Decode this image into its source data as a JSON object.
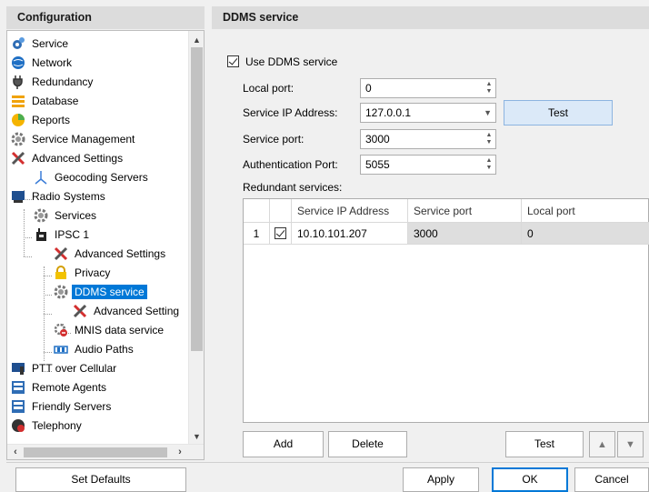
{
  "left_pane": {
    "title": "Configuration",
    "tree": [
      {
        "label": "Service",
        "icon": "gear-blue-icon"
      },
      {
        "label": "Network",
        "icon": "globe-icon"
      },
      {
        "label": "Redundancy",
        "icon": "plug-icon"
      },
      {
        "label": "Database",
        "icon": "database-icon"
      },
      {
        "label": "Reports",
        "icon": "reports-icon"
      },
      {
        "label": "Service Management",
        "icon": "gear-icon"
      },
      {
        "label": "Advanced Settings",
        "icon": "tools-icon"
      },
      {
        "label": "Geocoding Servers",
        "icon": "compass-icon"
      },
      {
        "label": "Radio Systems",
        "icon": "radio-systems-icon"
      },
      {
        "label": "Services",
        "icon": "gear-icon"
      },
      {
        "label": "IPSC 1",
        "icon": "radio-icon"
      },
      {
        "label": "Advanced Settings",
        "icon": "tools-icon"
      },
      {
        "label": "Privacy",
        "icon": "lock-icon"
      },
      {
        "label": "DDMS service",
        "icon": "gear-icon"
      },
      {
        "label": "Advanced Setting",
        "icon": "tools-icon"
      },
      {
        "label": "MNIS data service",
        "icon": "mnis-icon"
      },
      {
        "label": "Audio Paths",
        "icon": "audio-paths-icon"
      },
      {
        "label": "PTT over Cellular",
        "icon": "ptt-icon"
      },
      {
        "label": "Remote Agents",
        "icon": "agent-icon"
      },
      {
        "label": "Friendly Servers",
        "icon": "server-icon"
      },
      {
        "label": "Telephony",
        "icon": "phone-icon"
      }
    ],
    "set_defaults_label": "Set Defaults"
  },
  "right_pane": {
    "title": "DDMS service",
    "use_ddms_label": "Use DDMS service",
    "local_port_label": "Local port:",
    "local_port_value": "0",
    "service_ip_label": "Service IP Address:",
    "service_ip_value": "127.0.0.1",
    "test_label": "Test",
    "service_port_label": "Service port:",
    "service_port_value": "3000",
    "auth_port_label": "Authentication Port:",
    "auth_port_value": "5055",
    "redundant_label": "Redundant services:",
    "columns": [
      "Service IP Address",
      "Service port",
      "Local port"
    ],
    "rows": [
      {
        "index": "1",
        "ip": "10.10.101.207",
        "service_port": "3000",
        "local_port": "0"
      }
    ],
    "add_label": "Add",
    "delete_label": "Delete",
    "grid_test_label": "Test"
  },
  "footer": {
    "apply_label": "Apply",
    "ok_label": "OK",
    "cancel_label": "Cancel"
  },
  "colors": {
    "selection": "#0078d7",
    "header_bg": "#dcdcdc",
    "test_button_bg": "#dbe9f8"
  }
}
